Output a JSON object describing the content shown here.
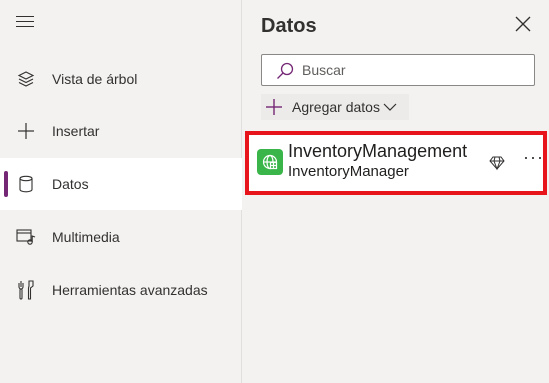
{
  "nav": {
    "items": [
      {
        "label": "Vista de árbol",
        "icon": "layers-icon"
      },
      {
        "label": "Insertar",
        "icon": "plus-icon"
      },
      {
        "label": "Datos",
        "icon": "database-icon",
        "active": true
      },
      {
        "label": "Multimedia",
        "icon": "media-icon"
      },
      {
        "label": "Herramientas avanzadas",
        "icon": "tools-icon"
      }
    ]
  },
  "panel": {
    "title": "Datos",
    "search_placeholder": "Buscar",
    "add_data_label": "Agregar datos",
    "datasource": {
      "name": "InventoryManagement",
      "subtitle": "InventoryManager",
      "more_label": "···"
    }
  },
  "colors": {
    "accent": "#742774",
    "highlight": "#e8141b",
    "dataverse_green": "#3ab54a"
  }
}
